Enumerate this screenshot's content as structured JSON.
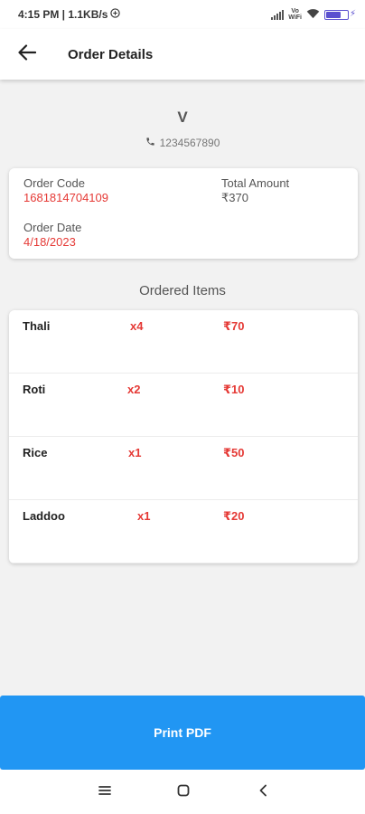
{
  "status_bar": {
    "time_text": "4:15 PM | 1.1KB/s",
    "sync_icon": "sync-circle-icon",
    "signal_icon": "signal-icon",
    "volte_text_1": "Vo",
    "volte_text_2": "WiFi",
    "wifi_icon": "wifi-icon",
    "battery_icon": "battery-charging-icon",
    "battery_color": "#5a4fcf"
  },
  "app_bar": {
    "back_icon": "arrow-left-icon",
    "title": "Order Details"
  },
  "customer": {
    "name": "V",
    "phone_icon": "phone-icon",
    "phone": "1234567890"
  },
  "order_info": {
    "order_code_label": "Order Code",
    "order_code": "1681814704109",
    "total_amount_label": "Total Amount",
    "total_amount": "₹370",
    "order_date_label": "Order Date",
    "order_date": "4/18/2023"
  },
  "ordered_items": {
    "title": "Ordered Items",
    "items": [
      {
        "name": "Thali",
        "qty": "x4",
        "price": "₹70"
      },
      {
        "name": "Roti",
        "qty": "x2",
        "price": "₹10"
      },
      {
        "name": "Rice",
        "qty": "x1",
        "price": "₹50"
      },
      {
        "name": "Laddoo",
        "qty": "x1",
        "price": "₹20"
      }
    ]
  },
  "actions": {
    "print_label": "Print PDF"
  },
  "nav_bar": {
    "menu_icon": "menu-icon",
    "home_icon": "home-square-icon",
    "back_icon": "chevron-left-icon"
  },
  "colors": {
    "accent_red": "#e53935",
    "button_blue": "#2196f3",
    "background": "#f2f2f2"
  }
}
